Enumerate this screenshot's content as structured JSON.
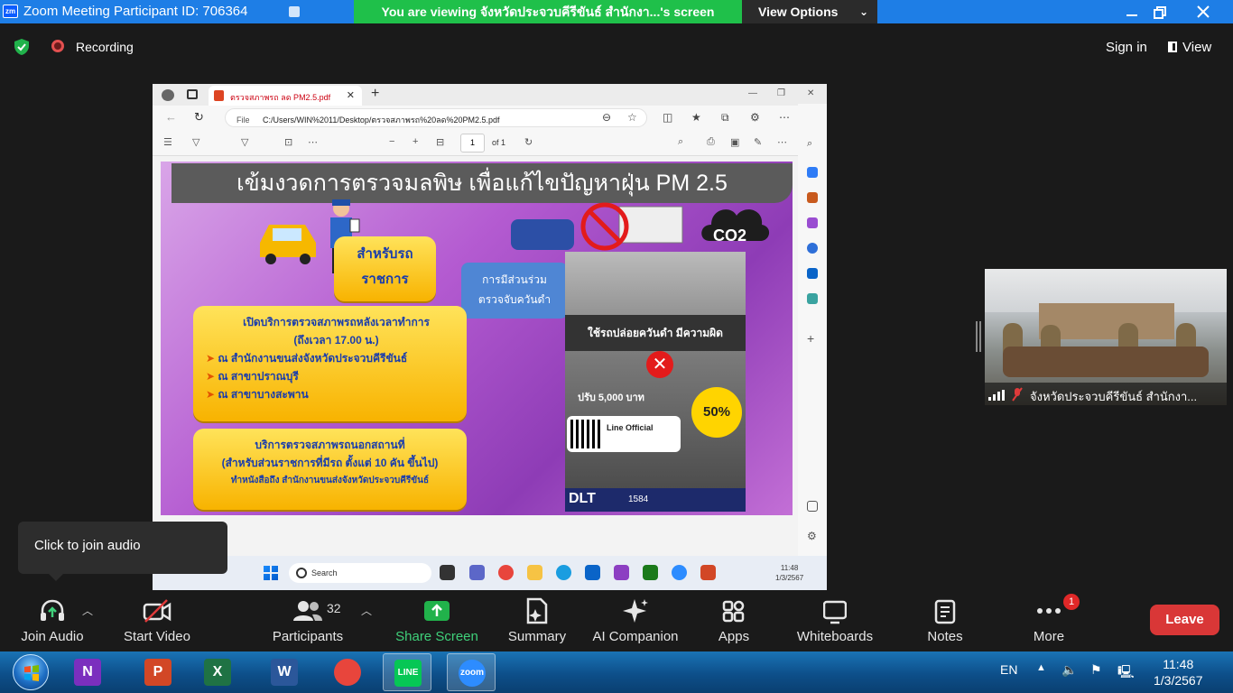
{
  "titlebar": {
    "logo": "zm",
    "title": "Zoom Meeting Participant ID: 706364",
    "banner": "You  are viewing จังหวัดประจวบคีรีขันธ์ สำนักงา...'s screen",
    "view_options": "View Options"
  },
  "topbar": {
    "recording": "Recording",
    "sign_in": "Sign in",
    "view": "View"
  },
  "shared_screen": {
    "browser": {
      "tab_title": "ตรวจสภาพรถ ลด PM2.5.pdf",
      "file_label": "File",
      "url": "C:/Users/WIN%2011/Desktop/ตรวจสภาพรถ%20ลด%20PM2.5.pdf",
      "page_number": "1",
      "page_of": "of 1"
    },
    "poster": {
      "headline": "เข้มงวดการตรวจมลพิษ เพื่อแก้ไขปัญหาฝุ่น PM 2.5",
      "for_gov_line1": "สำหรับรถ",
      "for_gov_line2": "ราชการ",
      "participate_line1": "การมีส่วนร่วม",
      "participate_line2": "ตรวจจับควันดำ",
      "open_title": "เปิดบริการตรวจสภาพรถหลังเวลาทำการ",
      "open_until": "(ถึงเวลา  17.00 น.)",
      "open_items": [
        "ณ  สำนักงานขนส่งจังหวัดประจวบคีรีขันธ์",
        "ณ  สาขาปราณบุรี",
        "ณ  สาขาบางสะพาน"
      ],
      "out_title": "บริการตรวจสภาพรถนอกสถานที่",
      "out_sub": "(สำหรับส่วนราชการที่มีรถ ตั้งแต่ 10 คัน ขึ้นไป)",
      "out_note": "ทำหนังสือถึง สำนักงานขนส่งจังหวัดประจวบคีรีขันธ์",
      "co2": "CO2",
      "flyer_headline": "ใช้รถปล่อยควันดำ มีความผิด",
      "flyer_percent": "50%",
      "flyer_fine": "ปรับ 5,000 บาท",
      "flyer_line": "Line Official",
      "flyer_dlt": "DLT",
      "flyer_hotline": "1584"
    },
    "inner_taskbar": {
      "search_placeholder": "Search",
      "time": "11:48",
      "date": "1/3/2567"
    }
  },
  "participant_video": {
    "name": "จังหวัดประจวบคีรีขันธ์ สำนักงา..."
  },
  "tooltip": {
    "text": "Click to join audio"
  },
  "toolbar": {
    "join_audio": "Join Audio",
    "start_video": "Start Video",
    "participants": "Participants",
    "participants_count": "32",
    "share_screen": "Share Screen",
    "summary": "Summary",
    "ai_companion": "AI Companion",
    "apps": "Apps",
    "whiteboards": "Whiteboards",
    "notes": "Notes",
    "more": "More",
    "more_badge": "1",
    "leave": "Leave"
  },
  "taskbar": {
    "apps": [
      {
        "name": "OneNote",
        "glyph": "N",
        "color": "#7b2fbe"
      },
      {
        "name": "PowerPoint",
        "glyph": "P",
        "color": "#d24726"
      },
      {
        "name": "Excel",
        "glyph": "X",
        "color": "#1f7244"
      },
      {
        "name": "Word",
        "glyph": "W",
        "color": "#2b579a"
      },
      {
        "name": "Chrome",
        "glyph": "",
        "color": "#e8453c"
      },
      {
        "name": "LINE",
        "glyph": "LINE",
        "color": "#06c755"
      },
      {
        "name": "Zoom",
        "glyph": "zoom",
        "color": "#2d8cff"
      }
    ],
    "language": "EN",
    "time": "11:48",
    "date": "1/3/2567"
  },
  "colors": {
    "zoom_blue": "#1e7ee6",
    "banner_green": "#1fc04a",
    "share_green": "#3fd07a",
    "leave_red": "#d93737"
  }
}
